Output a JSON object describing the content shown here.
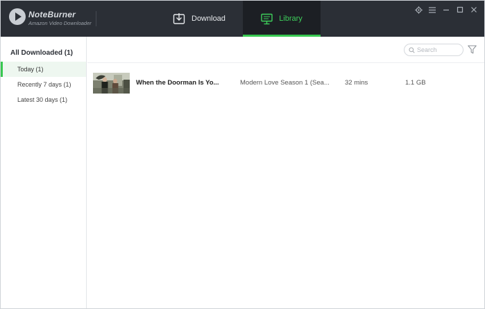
{
  "app": {
    "name": "NoteBurner",
    "subtitle": "Amazon Video Downloader"
  },
  "tabs": {
    "download": "Download",
    "library": "Library"
  },
  "colors": {
    "accent": "#37c850",
    "titlebar": "#2b2f36",
    "active_tab_bg": "#1c1f24"
  },
  "sidebar": {
    "all": "All Downloaded (1)",
    "items": [
      {
        "label": "Today (1)",
        "active": true
      },
      {
        "label": "Recently 7 days (1)",
        "active": false
      },
      {
        "label": "Latest 30 days (1)",
        "active": false
      }
    ]
  },
  "toolbar": {
    "search_placeholder": "Search"
  },
  "items": [
    {
      "title": "When the Doorman Is Yo...",
      "show": "Modern Love Season 1 (Sea...",
      "duration": "32 mins",
      "size": "1.1 GB"
    }
  ],
  "icons": [
    "app-logo-icon",
    "download-icon",
    "monitor-icon",
    "settings-icon",
    "menu-icon",
    "minimize-icon",
    "maximize-icon",
    "close-icon",
    "search-icon",
    "filter-icon"
  ]
}
